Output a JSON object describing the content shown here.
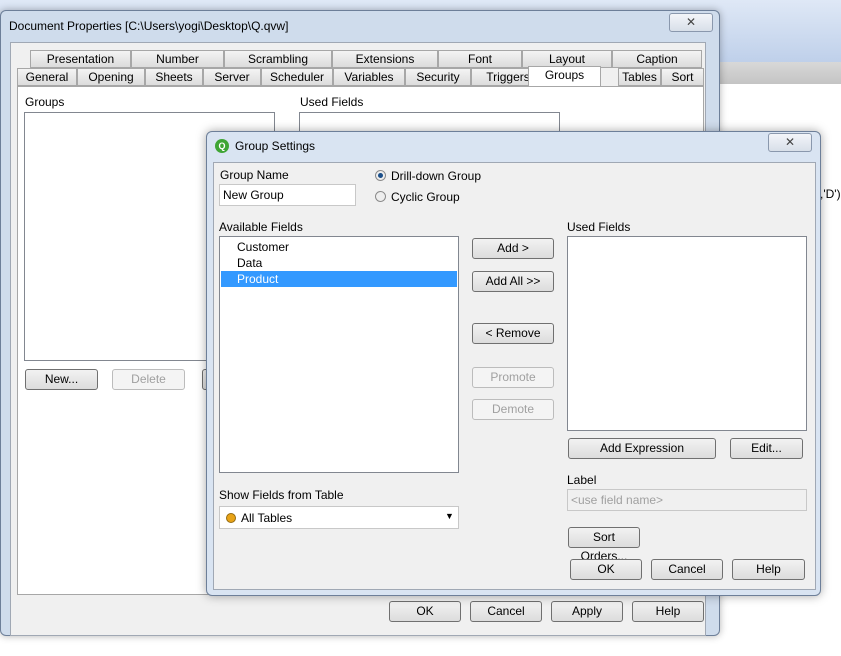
{
  "background": {
    "partial_text": ",'D')"
  },
  "doc_props": {
    "title": "Document Properties [C:\\Users\\yogi\\Desktop\\Q.qvw]",
    "close_icon": "close-x-icon",
    "tabs_row1": [
      "Presentation",
      "Number",
      "Scrambling",
      "Extensions",
      "Font",
      "Layout",
      "Caption"
    ],
    "tabs_row2": [
      "General",
      "Opening",
      "Sheets",
      "Server",
      "Scheduler",
      "Variables",
      "Security",
      "Triggers",
      "Groups",
      "Tables",
      "Sort"
    ],
    "active_tab": "Groups",
    "groups_label": "Groups",
    "used_fields_label": "Used Fields",
    "new_button": "New...",
    "delete_button": "Delete",
    "ok": "OK",
    "cancel": "Cancel",
    "apply": "Apply",
    "help": "Help"
  },
  "group_settings": {
    "title": "Group Settings",
    "group_name_label": "Group Name",
    "group_name_value": "New Group",
    "radio_drilldown": "Drill-down Group",
    "radio_cyclic": "Cyclic Group",
    "selected_type": "Drill-down Group",
    "available_fields_label": "Available Fields",
    "available_fields": [
      "Customer",
      "Data",
      "Product"
    ],
    "selected_field": "Product",
    "used_fields_label": "Used Fields",
    "add": "Add >",
    "add_all": "Add All >>",
    "remove": "< Remove",
    "promote": "Promote",
    "demote": "Demote",
    "add_expression": "Add Expression",
    "edit": "Edit...",
    "label_label": "Label",
    "label_placeholder": "<use field name>",
    "show_fields_label": "Show Fields from Table",
    "show_fields_value": "All Tables",
    "sort_orders": "Sort Orders...",
    "ok": "OK",
    "cancel": "Cancel",
    "help": "Help",
    "colors": {
      "selection": "#3399ff",
      "logo": "#3fa535",
      "table_dot": "#e8a317"
    }
  }
}
